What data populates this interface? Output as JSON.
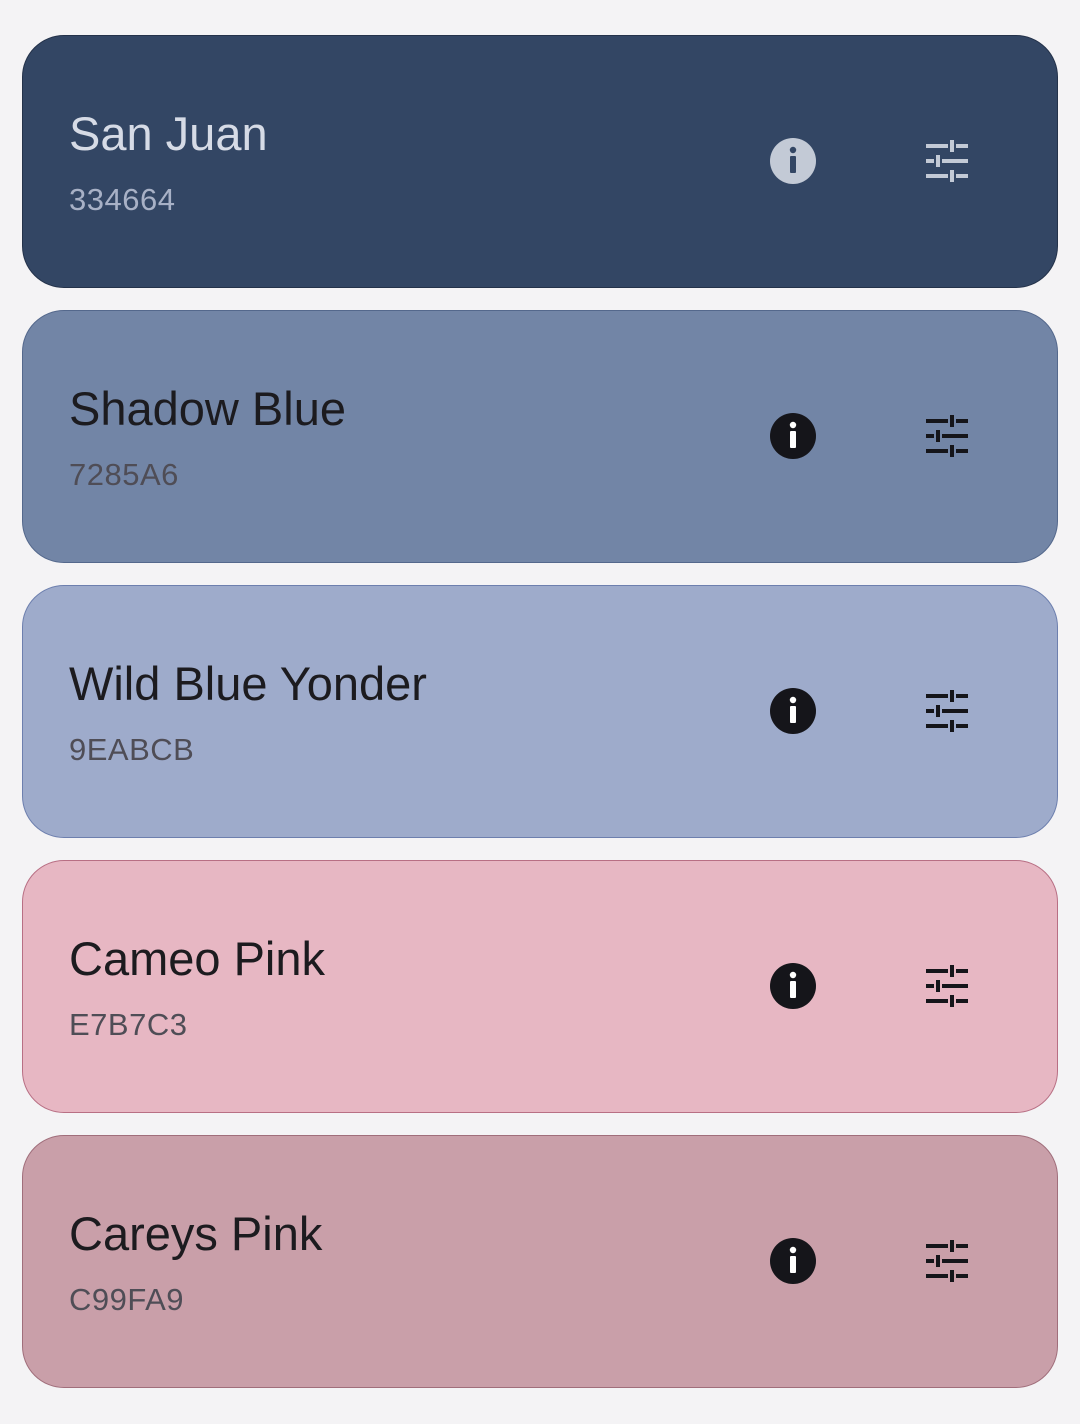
{
  "colors": [
    {
      "name": "San Juan",
      "hex": "334664",
      "background": "#334664",
      "border": "#24324a",
      "theme": "dark",
      "icon_color": "#c3cad6",
      "info_glyph_color": "#334664"
    },
    {
      "name": "Shadow Blue",
      "hex": "7285A6",
      "background": "#7285a6",
      "border": "#54688c",
      "theme": "light",
      "icon_color": "#15151a",
      "info_glyph_color": "#ffffff"
    },
    {
      "name": "Wild Blue Yonder",
      "hex": "9EABCB",
      "background": "#9eabcb",
      "border": "#6d7fae",
      "theme": "light",
      "icon_color": "#15151a",
      "info_glyph_color": "#ffffff"
    },
    {
      "name": "Cameo Pink",
      "hex": "E7B7C3",
      "background": "#e7b7c3",
      "border": "#b86f84",
      "theme": "light",
      "icon_color": "#15151a",
      "info_glyph_color": "#ffffff"
    },
    {
      "name": "Careys Pink",
      "hex": "C99FA9",
      "background": "#c99fa9",
      "border": "#a06e7b",
      "theme": "light",
      "icon_color": "#15151a",
      "info_glyph_color": "#ffffff"
    }
  ],
  "icons": {
    "info": "info-icon",
    "adjust": "tune-icon"
  }
}
